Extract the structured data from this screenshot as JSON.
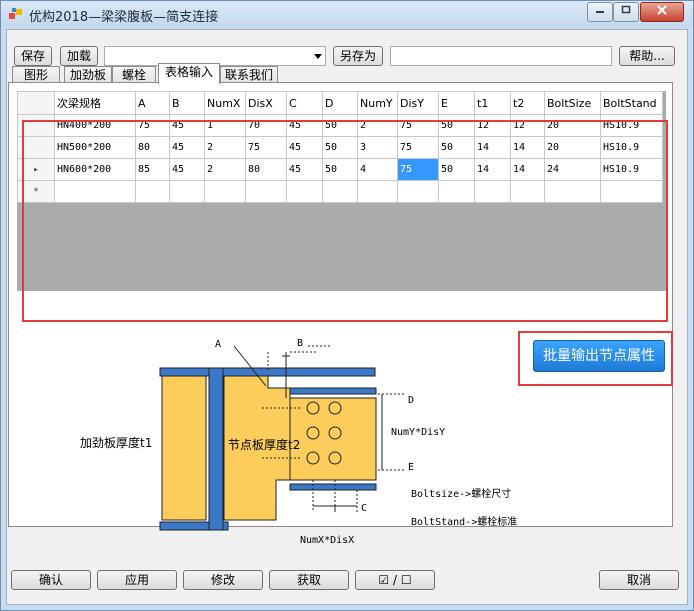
{
  "window": {
    "title": "优构2018—梁梁腹板—简支连接",
    "min_icon": "minimize-icon",
    "max_icon": "maximize-icon",
    "close_icon": "close-icon"
  },
  "toolbar": {
    "save_label": "保存",
    "load_label": "加载",
    "combo_value": "",
    "save_as_label": "另存为",
    "name_value": "",
    "help_label": "帮助..."
  },
  "tabs": [
    {
      "label": "图形",
      "active": false
    },
    {
      "label": "加劲板",
      "active": false
    },
    {
      "label": "螺栓",
      "active": false
    },
    {
      "label": "表格输入",
      "active": true
    },
    {
      "label": "联系我们",
      "active": false
    }
  ],
  "grid": {
    "columns": [
      "次梁规格",
      "A",
      "B",
      "NumX",
      "DisX",
      "C",
      "D",
      "NumY",
      "DisY",
      "E",
      "t1",
      "t2",
      "BoltSize",
      "BoltStand"
    ],
    "rows": [
      [
        "HN400*200",
        "75",
        "45",
        "1",
        "70",
        "45",
        "50",
        "2",
        "75",
        "50",
        "12",
        "12",
        "20",
        "HS10.9"
      ],
      [
        "HN500*200",
        "80",
        "45",
        "2",
        "75",
        "45",
        "50",
        "3",
        "75",
        "50",
        "14",
        "14",
        "20",
        "HS10.9"
      ],
      [
        "HN600*200",
        "85",
        "45",
        "2",
        "80",
        "45",
        "50",
        "4",
        "75",
        "50",
        "14",
        "14",
        "24",
        "HS10.9"
      ]
    ],
    "current_row_marker": "▸",
    "new_row_marker": "*",
    "selected_cell": {
      "row": 2,
      "col": 8
    }
  },
  "batch_button_label": "批量输出节点属性",
  "diagram": {
    "label_A": "A",
    "label_B": "B",
    "label_C": "C",
    "label_D": "D",
    "label_E": "E",
    "stiffener_label": "加劲板厚度t1",
    "plate_label": "节点板厚度t2",
    "numy_label": "NumY*DisY",
    "numx_label": "NumX*DisX",
    "boltsize_label": "Boltsize->螺栓尺寸",
    "boltstand_label": "BoltStand->螺栓标准",
    "colors": {
      "steel": "#fccd5b",
      "plate": "#fccd5b",
      "beam": "#3b78c7",
      "outline": "#222222"
    }
  },
  "footer": {
    "confirm_label": "确认",
    "apply_label": "应用",
    "modify_label": "修改",
    "get_label": "获取",
    "toggle_label": "☑ / ☐",
    "cancel_label": "取消"
  },
  "highlight_color": "#e03c3c"
}
